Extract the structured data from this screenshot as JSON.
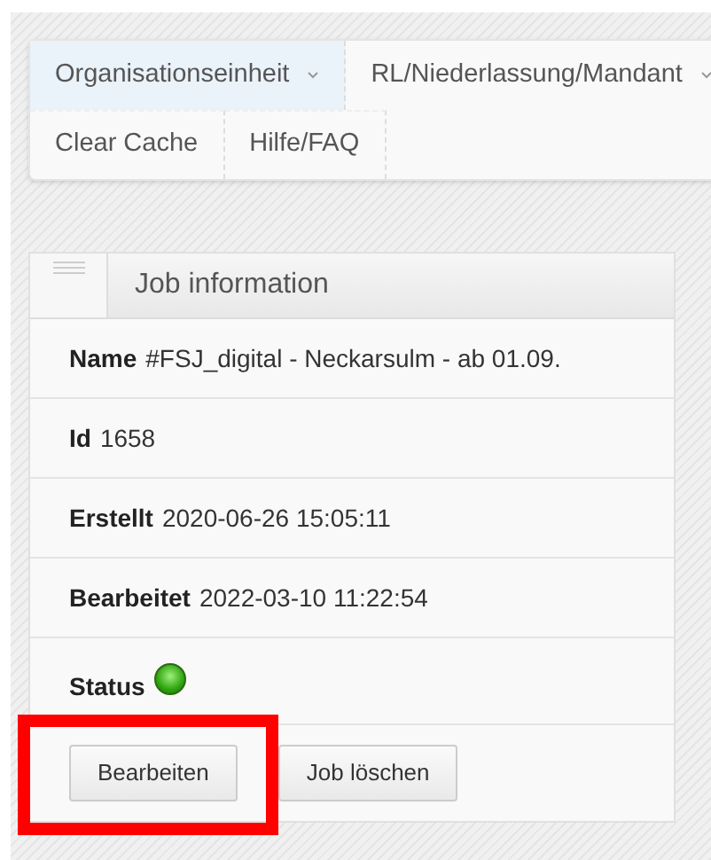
{
  "nav": {
    "rows": [
      [
        {
          "label": "Organisationseinheit",
          "dropdown": true,
          "selected": true
        },
        {
          "label": "RL/Niederlassung/Mandant",
          "dropdown": true,
          "selected": false
        }
      ],
      [
        {
          "label": "Clear Cache",
          "dropdown": false,
          "selected": false
        },
        {
          "label": "Hilfe/FAQ",
          "dropdown": false,
          "selected": false
        }
      ]
    ]
  },
  "card": {
    "title": "Job information",
    "fields": [
      {
        "kind": "text",
        "label": "Name",
        "value": "#FSJ_digital - Neckarsulm - ab 01.09."
      },
      {
        "kind": "text",
        "label": "Id",
        "value": "1658"
      },
      {
        "kind": "text",
        "label": "Erstellt",
        "value": "2020-06-26 15:05:11"
      },
      {
        "kind": "text",
        "label": "Bearbeitet",
        "value": "2022-03-10 11:22:54"
      },
      {
        "kind": "status",
        "label": "Status",
        "on": true
      }
    ],
    "buttons": [
      {
        "label": "Bearbeiten",
        "highlighted": true
      },
      {
        "label": "Job löschen",
        "highlighted": false
      }
    ]
  }
}
